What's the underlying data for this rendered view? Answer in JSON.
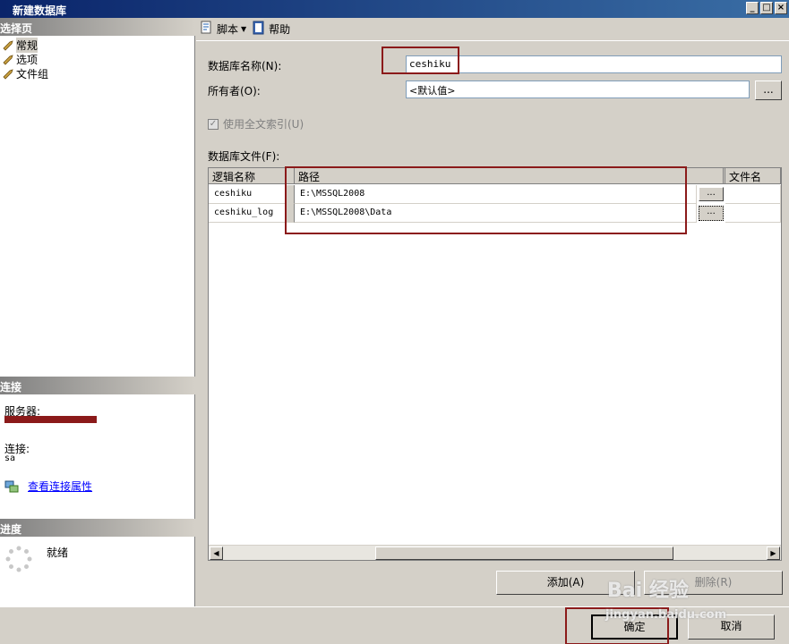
{
  "window": {
    "title": "新建数据库"
  },
  "left": {
    "select_page_header": "选择页",
    "pages": [
      {
        "label": "常规",
        "selected": true
      },
      {
        "label": "选项",
        "selected": false
      },
      {
        "label": "文件组",
        "selected": false
      }
    ],
    "connection_header": "连接",
    "server_label": "服务器:",
    "connection_label": "连接:",
    "connection_value": "sa",
    "view_props_link": "查看连接属性",
    "progress_header": "进度",
    "progress_status": "就绪"
  },
  "toolbar": {
    "script_label": "脚本",
    "help_label": "帮助"
  },
  "form": {
    "dbname_label": "数据库名称(N):",
    "dbname_value": "ceshiku",
    "owner_label": "所有者(O):",
    "owner_value": "<默认值>",
    "owner_browse": "...",
    "fulltext_label": "使用全文索引(U)",
    "dbfiles_label": "数据库文件(F):"
  },
  "table": {
    "headers": [
      "逻辑名称",
      "路径",
      "",
      "文件名"
    ],
    "rows": [
      {
        "logical": "ceshiku",
        "path": "E:\\MSSQL2008",
        "browse": "..."
      },
      {
        "logical": "ceshiku_log",
        "path": "E:\\MSSQL2008\\Data",
        "browse": "..."
      }
    ]
  },
  "buttons": {
    "add": "添加(A)",
    "remove": "删除(R)",
    "ok": "确定",
    "cancel": "取消"
  },
  "watermark": {
    "line1": "Bai 经验",
    "line2": "jingyan.baidu.com"
  }
}
